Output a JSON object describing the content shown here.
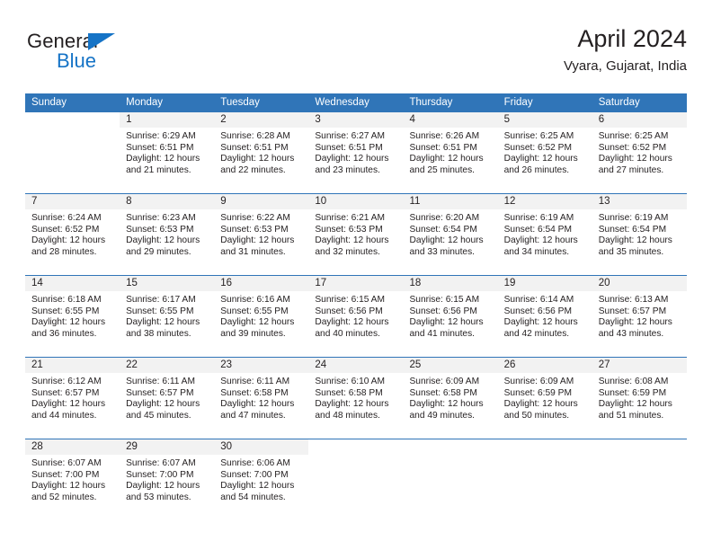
{
  "brand": {
    "word_top": "General",
    "word_bottom": "Blue",
    "accent_color": "#1573c6"
  },
  "header": {
    "title": "April 2024",
    "subtitle": "Vyara, Gujarat, India"
  },
  "theme": {
    "header_bg": "#3075b8",
    "daynum_band": "#f2f2f2",
    "text": "#231f20"
  },
  "weekdays": [
    "Sunday",
    "Monday",
    "Tuesday",
    "Wednesday",
    "Thursday",
    "Friday",
    "Saturday"
  ],
  "weeks": [
    [
      {
        "day": "",
        "lines": []
      },
      {
        "day": "1",
        "lines": [
          "Sunrise: 6:29 AM",
          "Sunset: 6:51 PM",
          "Daylight: 12 hours",
          "and 21 minutes."
        ]
      },
      {
        "day": "2",
        "lines": [
          "Sunrise: 6:28 AM",
          "Sunset: 6:51 PM",
          "Daylight: 12 hours",
          "and 22 minutes."
        ]
      },
      {
        "day": "3",
        "lines": [
          "Sunrise: 6:27 AM",
          "Sunset: 6:51 PM",
          "Daylight: 12 hours",
          "and 23 minutes."
        ]
      },
      {
        "day": "4",
        "lines": [
          "Sunrise: 6:26 AM",
          "Sunset: 6:51 PM",
          "Daylight: 12 hours",
          "and 25 minutes."
        ]
      },
      {
        "day": "5",
        "lines": [
          "Sunrise: 6:25 AM",
          "Sunset: 6:52 PM",
          "Daylight: 12 hours",
          "and 26 minutes."
        ]
      },
      {
        "day": "6",
        "lines": [
          "Sunrise: 6:25 AM",
          "Sunset: 6:52 PM",
          "Daylight: 12 hours",
          "and 27 minutes."
        ]
      }
    ],
    [
      {
        "day": "7",
        "lines": [
          "Sunrise: 6:24 AM",
          "Sunset: 6:52 PM",
          "Daylight: 12 hours",
          "and 28 minutes."
        ]
      },
      {
        "day": "8",
        "lines": [
          "Sunrise: 6:23 AM",
          "Sunset: 6:53 PM",
          "Daylight: 12 hours",
          "and 29 minutes."
        ]
      },
      {
        "day": "9",
        "lines": [
          "Sunrise: 6:22 AM",
          "Sunset: 6:53 PM",
          "Daylight: 12 hours",
          "and 31 minutes."
        ]
      },
      {
        "day": "10",
        "lines": [
          "Sunrise: 6:21 AM",
          "Sunset: 6:53 PM",
          "Daylight: 12 hours",
          "and 32 minutes."
        ]
      },
      {
        "day": "11",
        "lines": [
          "Sunrise: 6:20 AM",
          "Sunset: 6:54 PM",
          "Daylight: 12 hours",
          "and 33 minutes."
        ]
      },
      {
        "day": "12",
        "lines": [
          "Sunrise: 6:19 AM",
          "Sunset: 6:54 PM",
          "Daylight: 12 hours",
          "and 34 minutes."
        ]
      },
      {
        "day": "13",
        "lines": [
          "Sunrise: 6:19 AM",
          "Sunset: 6:54 PM",
          "Daylight: 12 hours",
          "and 35 minutes."
        ]
      }
    ],
    [
      {
        "day": "14",
        "lines": [
          "Sunrise: 6:18 AM",
          "Sunset: 6:55 PM",
          "Daylight: 12 hours",
          "and 36 minutes."
        ]
      },
      {
        "day": "15",
        "lines": [
          "Sunrise: 6:17 AM",
          "Sunset: 6:55 PM",
          "Daylight: 12 hours",
          "and 38 minutes."
        ]
      },
      {
        "day": "16",
        "lines": [
          "Sunrise: 6:16 AM",
          "Sunset: 6:55 PM",
          "Daylight: 12 hours",
          "and 39 minutes."
        ]
      },
      {
        "day": "17",
        "lines": [
          "Sunrise: 6:15 AM",
          "Sunset: 6:56 PM",
          "Daylight: 12 hours",
          "and 40 minutes."
        ]
      },
      {
        "day": "18",
        "lines": [
          "Sunrise: 6:15 AM",
          "Sunset: 6:56 PM",
          "Daylight: 12 hours",
          "and 41 minutes."
        ]
      },
      {
        "day": "19",
        "lines": [
          "Sunrise: 6:14 AM",
          "Sunset: 6:56 PM",
          "Daylight: 12 hours",
          "and 42 minutes."
        ]
      },
      {
        "day": "20",
        "lines": [
          "Sunrise: 6:13 AM",
          "Sunset: 6:57 PM",
          "Daylight: 12 hours",
          "and 43 minutes."
        ]
      }
    ],
    [
      {
        "day": "21",
        "lines": [
          "Sunrise: 6:12 AM",
          "Sunset: 6:57 PM",
          "Daylight: 12 hours",
          "and 44 minutes."
        ]
      },
      {
        "day": "22",
        "lines": [
          "Sunrise: 6:11 AM",
          "Sunset: 6:57 PM",
          "Daylight: 12 hours",
          "and 45 minutes."
        ]
      },
      {
        "day": "23",
        "lines": [
          "Sunrise: 6:11 AM",
          "Sunset: 6:58 PM",
          "Daylight: 12 hours",
          "and 47 minutes."
        ]
      },
      {
        "day": "24",
        "lines": [
          "Sunrise: 6:10 AM",
          "Sunset: 6:58 PM",
          "Daylight: 12 hours",
          "and 48 minutes."
        ]
      },
      {
        "day": "25",
        "lines": [
          "Sunrise: 6:09 AM",
          "Sunset: 6:58 PM",
          "Daylight: 12 hours",
          "and 49 minutes."
        ]
      },
      {
        "day": "26",
        "lines": [
          "Sunrise: 6:09 AM",
          "Sunset: 6:59 PM",
          "Daylight: 12 hours",
          "and 50 minutes."
        ]
      },
      {
        "day": "27",
        "lines": [
          "Sunrise: 6:08 AM",
          "Sunset: 6:59 PM",
          "Daylight: 12 hours",
          "and 51 minutes."
        ]
      }
    ],
    [
      {
        "day": "28",
        "lines": [
          "Sunrise: 6:07 AM",
          "Sunset: 7:00 PM",
          "Daylight: 12 hours",
          "and 52 minutes."
        ]
      },
      {
        "day": "29",
        "lines": [
          "Sunrise: 6:07 AM",
          "Sunset: 7:00 PM",
          "Daylight: 12 hours",
          "and 53 minutes."
        ]
      },
      {
        "day": "30",
        "lines": [
          "Sunrise: 6:06 AM",
          "Sunset: 7:00 PM",
          "Daylight: 12 hours",
          "and 54 minutes."
        ]
      },
      {
        "day": "",
        "lines": []
      },
      {
        "day": "",
        "lines": []
      },
      {
        "day": "",
        "lines": []
      },
      {
        "day": "",
        "lines": []
      }
    ]
  ]
}
